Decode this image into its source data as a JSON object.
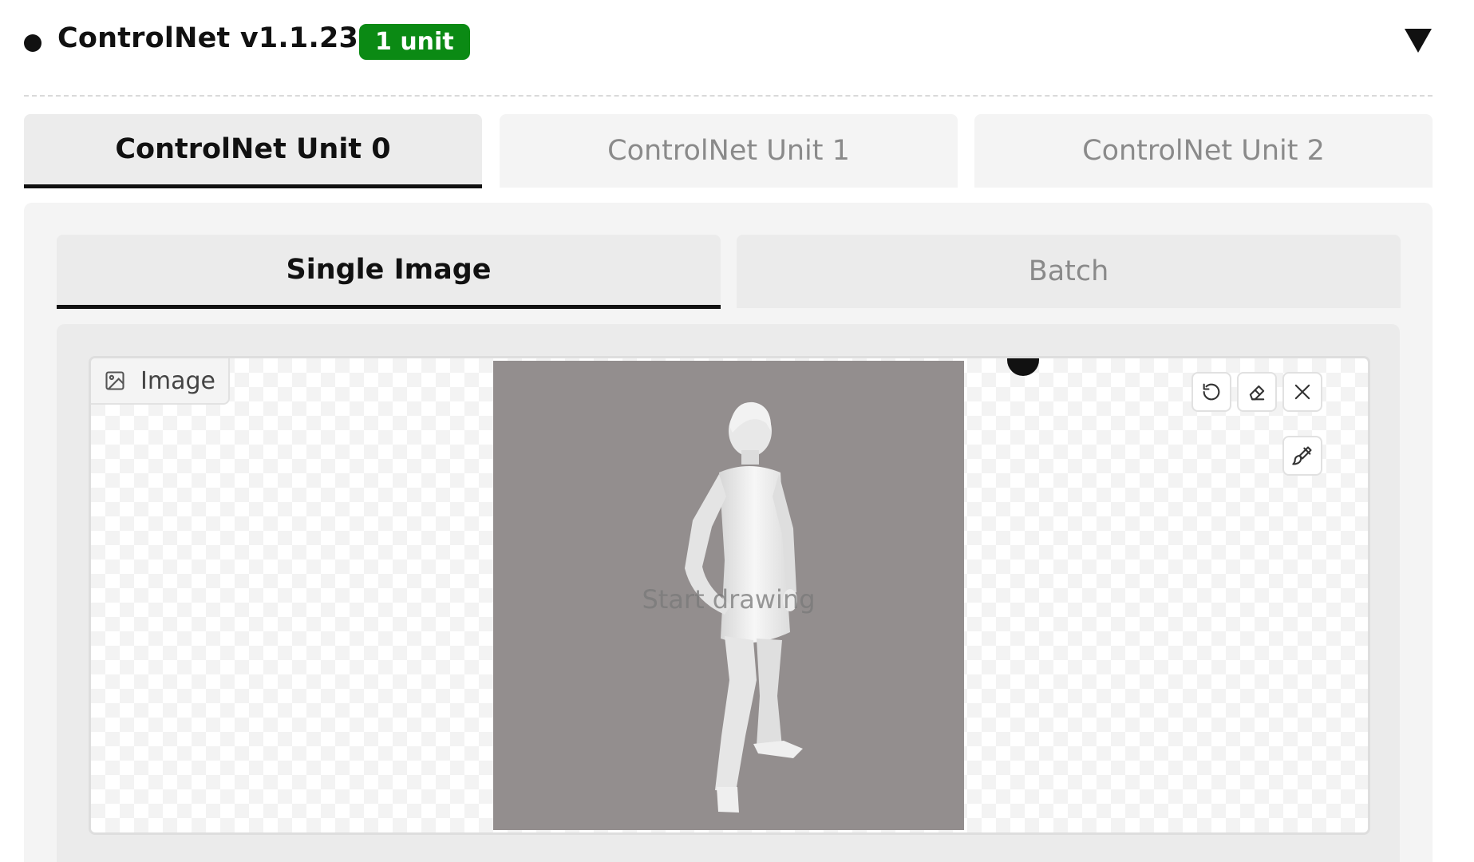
{
  "header": {
    "title": "ControlNet v1.1.237",
    "badge": "1 unit",
    "badge_color": "#0b8a14",
    "collapse_icon": "triangle-down-icon"
  },
  "unit_tabs": [
    {
      "label": "ControlNet Unit 0",
      "active": true
    },
    {
      "label": "ControlNet Unit 1",
      "active": false
    },
    {
      "label": "ControlNet Unit 2",
      "active": false
    }
  ],
  "mode_tabs": [
    {
      "label": "Single Image",
      "active": true
    },
    {
      "label": "Batch",
      "active": false
    }
  ],
  "image_input": {
    "label": "Image",
    "label_icon": "image-icon",
    "overlay_text": "Start drawing",
    "canvas_background": "#938e8e",
    "tools": [
      {
        "name": "undo-icon"
      },
      {
        "name": "eraser-icon"
      },
      {
        "name": "close-icon"
      },
      {
        "name": "brush-icon"
      }
    ]
  }
}
